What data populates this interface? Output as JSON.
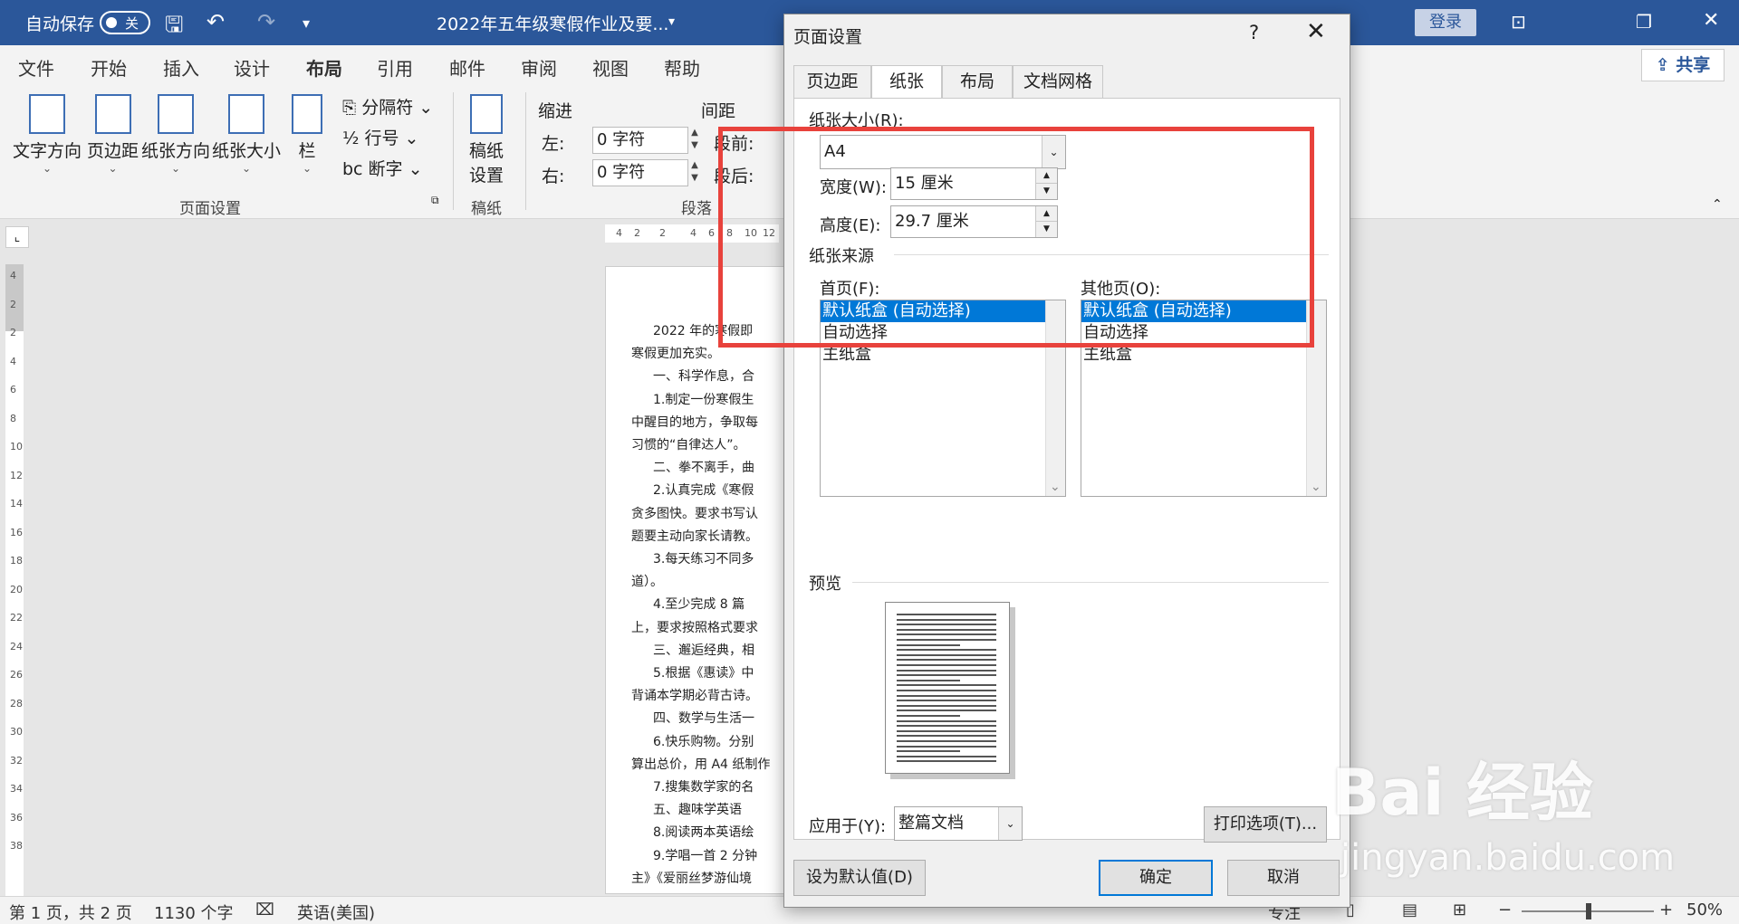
{
  "titlebar": {
    "autosave_label": "自动保存",
    "autosave_state": "关",
    "doc_title": "2022年五年级寒假作业及要...",
    "login_label": "登录"
  },
  "ribbon_tabs": [
    "文件",
    "开始",
    "插入",
    "设计",
    "布局",
    "引用",
    "邮件",
    "审阅",
    "视图",
    "帮助"
  ],
  "share_label": "共享",
  "ribbon": {
    "text_direction": "文字方向",
    "margins": "页边距",
    "orientation": "纸张方向",
    "size": "纸张大小",
    "columns": "栏",
    "breaks": "分隔符",
    "line_numbers": "行号",
    "hyphenation": "断字",
    "page_setup_group": "页面设置",
    "manuscript": "稿纸\n设置",
    "manuscript_group": "稿纸",
    "indent_label": "缩进",
    "spacing_label": "间距",
    "left_label": "左:",
    "right_label": "右:",
    "left_value": "0 字符",
    "right_value": "0 字符",
    "before_label": "段前:",
    "after_label": "段后:",
    "paragraph_group": "段落"
  },
  "ruler_h_ticks": [
    "4",
    "2",
    "2",
    "4",
    "6",
    "8",
    "10",
    "12"
  ],
  "ruler_v_ticks": [
    "4",
    "2",
    "2",
    "4",
    "6",
    "8",
    "10",
    "12",
    "14",
    "16",
    "18",
    "20",
    "22",
    "24",
    "26",
    "28",
    "30",
    "32",
    "34",
    "36",
    "38"
  ],
  "document_lines": [
    "2022 年的寒假即",
    "寒假更加充实。",
    "一、科学作息，合",
    "1.制定一份寒假生",
    "中醒目的地方，争取每",
    "习惯的“自律达人”。",
    "二、拳不离手，曲",
    "2.认真完成《寒假",
    "贪多图快。要求书写认",
    "题要主动向家长请教。",
    "3.每天练习不同多",
    "道）。",
    "4.至少完成 8 篇",
    "上，要求按照格式要求",
    "三、邂逅经典，相",
    "5.根据《惠读》中",
    "背诵本学期必背古诗。",
    "四、数学与生活一",
    "6.快乐购物。分别",
    "算出总价，用 A4 纸制作",
    "7.搜集数学家的名",
    "五、趣味学英语",
    "8.阅读两本英语绘",
    "9.学唱一首 2 分钟",
    "主》《爱丽丝梦游仙境"
  ],
  "statusbar": {
    "page": "第 1 页，共 2 页",
    "words": "1130 个字",
    "language": "英语(美国)",
    "focus": "专注",
    "zoom": "50%"
  },
  "dialog": {
    "title": "页面设置",
    "help": "?",
    "tabs": [
      "页边距",
      "纸张",
      "布局",
      "文档网格"
    ],
    "active_tab": "纸张",
    "paper_size_label": "纸张大小(R):",
    "paper_size_value": "A4",
    "width_label": "宽度(W):",
    "width_value": "15 厘米",
    "height_label": "高度(E):",
    "height_value": "29.7 厘米",
    "paper_source_label": "纸张来源",
    "first_page_label": "首页(F):",
    "other_pages_label": "其他页(O):",
    "first_page_items": [
      "默认纸盒 (自动选择)",
      "自动选择",
      "主纸盒"
    ],
    "other_pages_items": [
      "默认纸盒 (自动选择)",
      "自动选择",
      "主纸盒"
    ],
    "preview_label": "预览",
    "apply_to_label": "应用于(Y):",
    "apply_to_value": "整篇文档",
    "print_options": "打印选项(T)...",
    "set_default": "设为默认值(D)",
    "ok": "确定",
    "cancel": "取消"
  },
  "watermark": {
    "brand": "Bai 经验",
    "url": "jingyan.baidu.com"
  },
  "colors": {
    "titlebar": "#2b579a",
    "annotation_red": "#e8423c",
    "selection_blue": "#0078d7"
  }
}
